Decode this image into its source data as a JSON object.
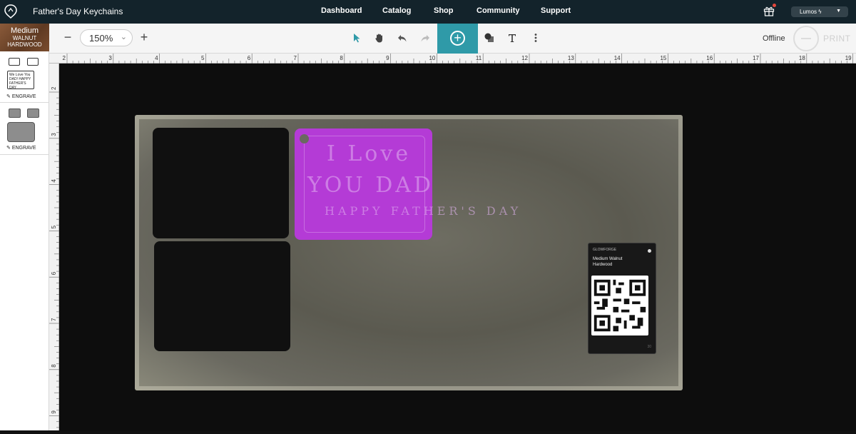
{
  "nav": {
    "title": "Father's Day Keychains",
    "links": [
      "Dashboard",
      "Catalog",
      "Shop",
      "Community",
      "Support"
    ],
    "user": "Lumos"
  },
  "sidebar": {
    "material_grade": "Medium",
    "material_name": "WALNUT\nHARDWOOD",
    "note_text": "We Love You DAD! HAPPY FATHER'S DAY",
    "group1_action": "ENGRAVE",
    "group2_action": "ENGRAVE"
  },
  "toolbar": {
    "zoom": "150%",
    "status": "Offline",
    "print": "PRINT"
  },
  "ruler": {
    "top": [
      "2",
      "3",
      "4",
      "5",
      "6",
      "7",
      "8",
      "9",
      "10",
      "11",
      "12",
      "13",
      "14",
      "15",
      "16",
      "17",
      "18",
      "19"
    ],
    "left": [
      "2",
      "3",
      "4",
      "5",
      "6",
      "7",
      "8",
      "9"
    ]
  },
  "canvas": {
    "keychain_text": [
      "I Love",
      "YOU DAD",
      "HAPPY FATHER'S DAY"
    ],
    "label_brand": "GLOWFORGE",
    "label_material": "Medium Walnut Hardwood"
  },
  "colors": {
    "nav_bg": "#13232b",
    "accent": "#2f9aa8",
    "selection": "#b43bd6"
  }
}
